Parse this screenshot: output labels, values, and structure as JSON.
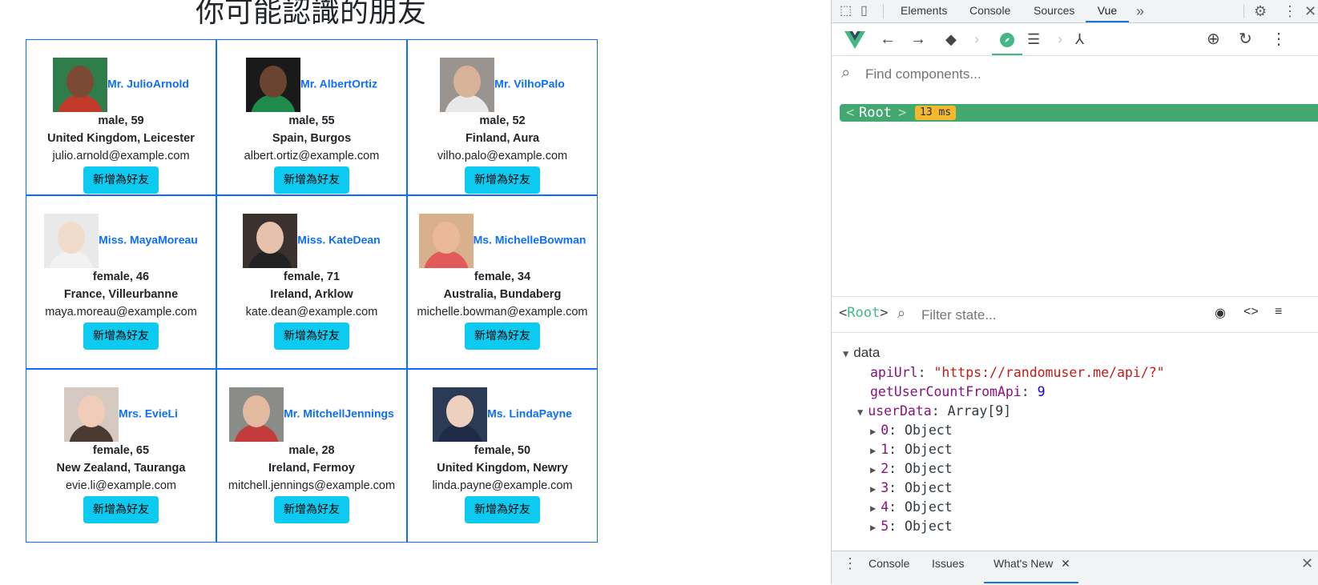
{
  "page": {
    "title": "你可能認識的朋友",
    "add_friend_label": "新增為好友",
    "friends": [
      {
        "name": "Mr. JulioArnold",
        "info": "male, 59",
        "location": "United Kingdom, Leicester",
        "email": "julio.arnold@example.com",
        "skin": "#7a4a32",
        "shirt": "#c23b2a",
        "bg": "#2e7d4a"
      },
      {
        "name": "Mr. AlbertOrtiz",
        "info": "male, 55",
        "location": "Spain, Burgos",
        "email": "albert.ortiz@example.com",
        "skin": "#6b4430",
        "shirt": "#1e8a4c",
        "bg": "#1a1a1a"
      },
      {
        "name": "Mr. VilhoPalo",
        "info": "male, 52",
        "location": "Finland, Aura",
        "email": "vilho.palo@example.com",
        "skin": "#d8b39a",
        "shirt": "#e8e8e8",
        "bg": "#9a9490"
      },
      {
        "name": "Miss. MayaMoreau",
        "info": "female, 46",
        "location": "France, Villeurbanne",
        "email": "maya.moreau@example.com",
        "skin": "#f1dccb",
        "shirt": "#f2f2f2",
        "bg": "#e9e9e9"
      },
      {
        "name": "Miss. KateDean",
        "info": "female, 71",
        "location": "Ireland, Arklow",
        "email": "kate.dean@example.com",
        "skin": "#e6c2ad",
        "shirt": "#222222",
        "bg": "#3b3230"
      },
      {
        "name": "Ms. MichelleBowman",
        "info": "female, 34",
        "location": "Australia, Bundaberg",
        "email": "michelle.bowman@example.com",
        "skin": "#e9b99a",
        "shirt": "#e25a5a",
        "bg": "#d9b08c"
      },
      {
        "name": "Mrs. EvieLi",
        "info": "female, 65",
        "location": "New Zealand, Tauranga",
        "email": "evie.li@example.com",
        "skin": "#efcdb8",
        "shirt": "#4a3a32",
        "bg": "#d6c9bf"
      },
      {
        "name": "Mr. MitchellJennings",
        "info": "male, 28",
        "location": "Ireland, Fermoy",
        "email": "mitchell.jennings@example.com",
        "skin": "#e3b9a0",
        "shirt": "#c43b3b",
        "bg": "#8a8c88"
      },
      {
        "name": "Ms. LindaPayne",
        "info": "female, 50",
        "location": "United Kingdom, Newry",
        "email": "linda.payne@example.com",
        "skin": "#eed0bf",
        "shirt": "#1f2a44",
        "bg": "#2b3a55"
      }
    ]
  },
  "devtools": {
    "tabs": [
      "Elements",
      "Console",
      "Sources",
      "Vue"
    ],
    "active_tab": "Vue",
    "more_tabs_icon": "»",
    "search_placeholder": "Find components...",
    "root_name": "Root",
    "root_time": "13 ms",
    "state_root": "Root",
    "filter_placeholder": "Filter state...",
    "section": "data",
    "fields": [
      {
        "key": "apiUrl",
        "value": "\"https://randomuser.me/api/?\"",
        "type": "str"
      },
      {
        "key": "getUserCountFromApi",
        "value": "9",
        "type": "num"
      },
      {
        "key": "userData",
        "value": "Array[9]",
        "type": "plain"
      }
    ],
    "user_items": [
      {
        "key": "0",
        "value": "Object"
      },
      {
        "key": "1",
        "value": "Object"
      },
      {
        "key": "2",
        "value": "Object"
      },
      {
        "key": "3",
        "value": "Object"
      },
      {
        "key": "4",
        "value": "Object"
      },
      {
        "key": "5",
        "value": "Object"
      }
    ],
    "drawer_tabs": [
      "Console",
      "Issues",
      "What's New"
    ],
    "drawer_active": "What's New",
    "colors": {
      "vue_green": "#42b883",
      "root_row": "#42a86f",
      "badge": "#f5b82e",
      "accent": "#1a73e8"
    }
  }
}
